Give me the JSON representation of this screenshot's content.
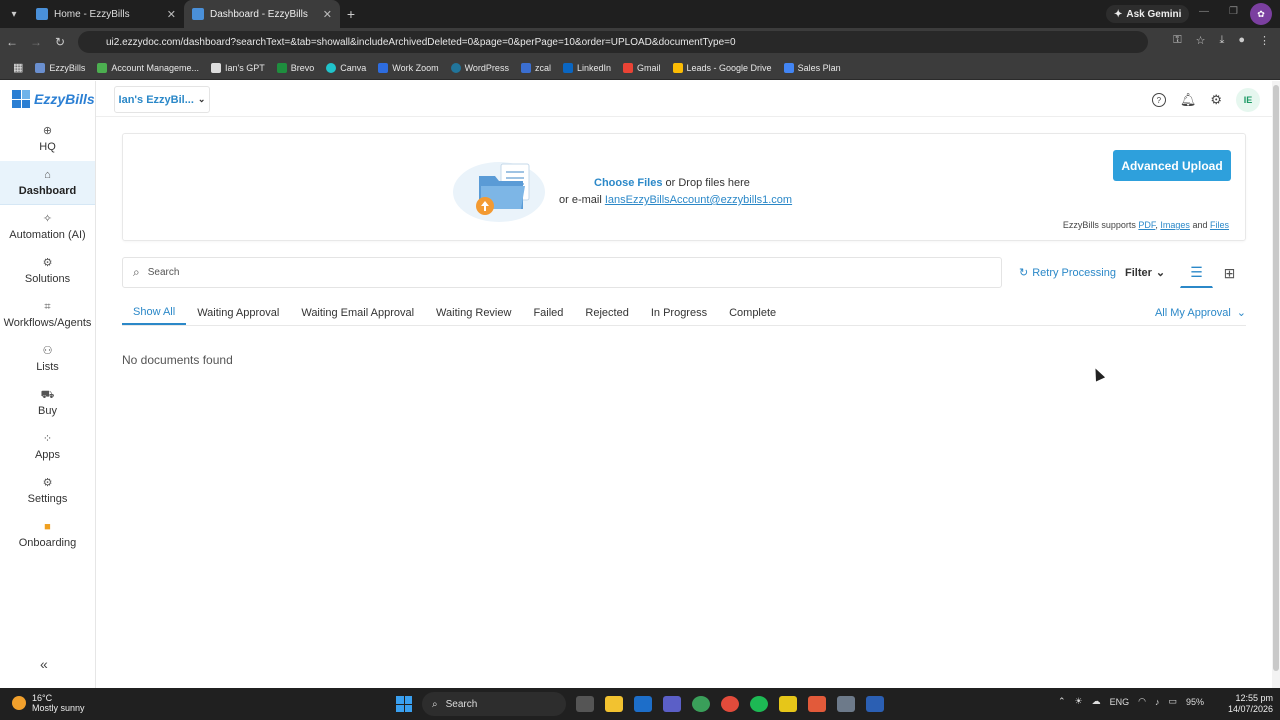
{
  "browser": {
    "tabs": [
      {
        "title": "Home - EzzyBills"
      },
      {
        "title": "Dashboard - EzzyBills"
      }
    ],
    "ask_gemini": "Ask Gemini",
    "url": "ui2.ezzydoc.com/dashboard?searchText=&tab=showall&includeArchivedDeleted=0&page=0&perPage=10&order=UPLOAD&documentType=0",
    "bookmarks": [
      "EzzyBills",
      "Account Manageme...",
      "Ian's GPT",
      "Brevo",
      "Canva",
      "Work Zoom",
      "WordPress",
      "zcal",
      "LinkedIn",
      "Gmail",
      "Leads - Google Drive",
      "Sales Plan"
    ]
  },
  "app": {
    "logo_text": "EzzyBills",
    "account_selector": "Ian's EzzyBil...",
    "user_initials": "IE",
    "sidebar": [
      {
        "label": "HQ",
        "icon": "globe-icon"
      },
      {
        "label": "Dashboard",
        "icon": "home-icon"
      },
      {
        "label": "Automation (AI)",
        "icon": "sparkle-icon"
      },
      {
        "label": "Solutions",
        "icon": "solutions-icon"
      },
      {
        "label": "Workflows/Agents",
        "icon": "workflow-icon"
      },
      {
        "label": "Lists",
        "icon": "users-icon"
      },
      {
        "label": "Buy",
        "icon": "cart-icon"
      },
      {
        "label": "Apps",
        "icon": "apps-icon"
      },
      {
        "label": "Settings",
        "icon": "gear-icon"
      },
      {
        "label": "Onboarding",
        "icon": "video-icon"
      }
    ],
    "upload": {
      "choose_files": "Choose Files",
      "drop_text": "or Drop files here",
      "email_prefix": "or e-mail",
      "email": "IansEzzyBillsAccount@ezzybills1.com",
      "advanced_upload": "Advanced Upload",
      "supports_prefix": "EzzyBills supports",
      "pdf": "PDF",
      "images": "Images",
      "and": "and",
      "files": "Files"
    },
    "search_placeholder": "Search",
    "retry_processing": "Retry Processing",
    "filter": "Filter",
    "filter_tabs": [
      "Show All",
      "Waiting Approval",
      "Waiting Email Approval",
      "Waiting Review",
      "Failed",
      "Rejected",
      "In Progress",
      "Complete"
    ],
    "approval_selector": "All My Approval",
    "empty_message": "No documents found",
    "accent_color": "#2b88c8"
  },
  "taskbar": {
    "temperature": "16°C",
    "weather": "Mostly sunny",
    "search": "Search",
    "language": "ENG",
    "battery": "95%",
    "time": "12:55 pm",
    "date": "14/07/2026"
  }
}
